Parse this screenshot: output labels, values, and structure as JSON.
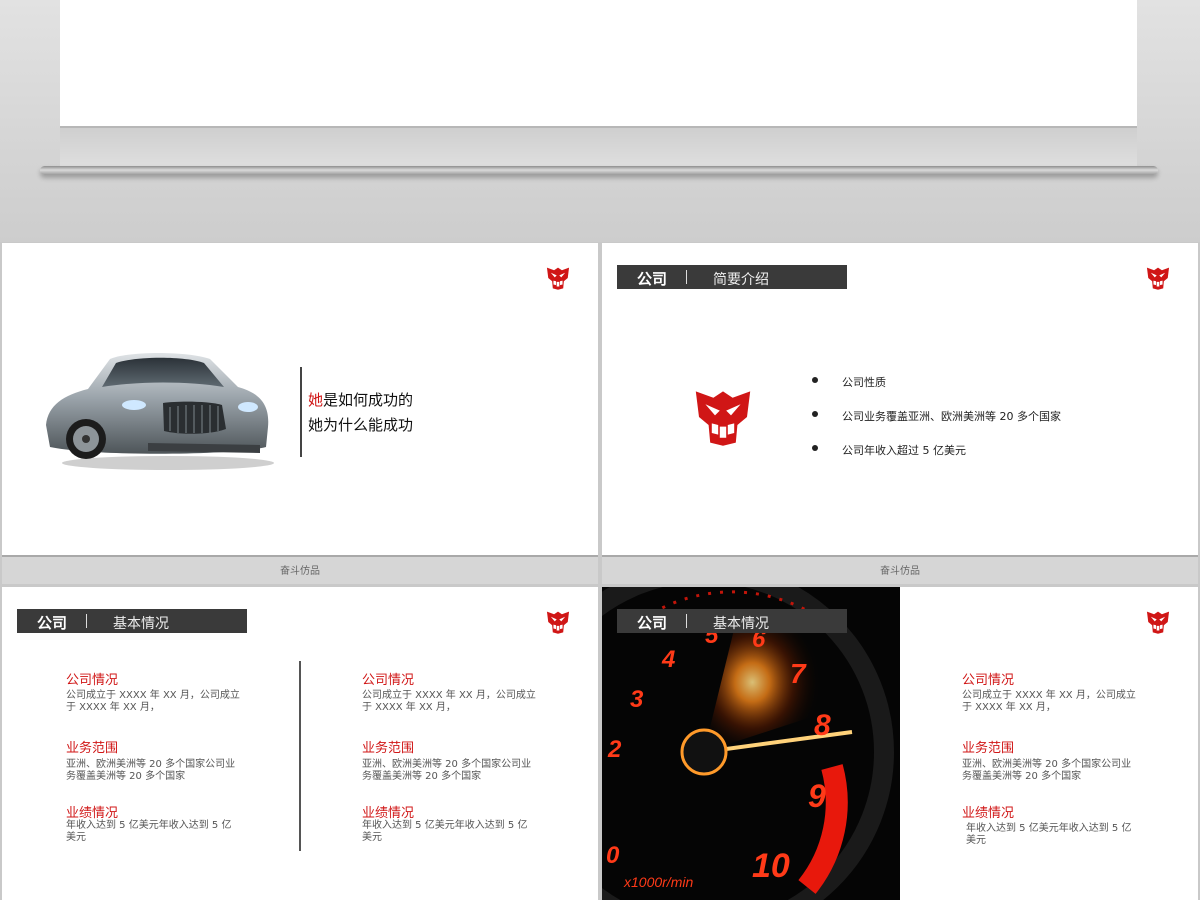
{
  "footer": {
    "label": "奋斗仿品"
  },
  "slide1": {
    "line1_highlight": "她",
    "line1_rest": "是如何成功的",
    "line2": "她为什么能成功"
  },
  "slide2": {
    "title": "公司",
    "subtitle": "简要介绍",
    "bullets": [
      "公司性质",
      "公司业务覆盖亚洲、欧洲美洲等 20 多个国家",
      "公司年收入超过 5 亿美元"
    ]
  },
  "slide3": {
    "title": "公司",
    "subtitle": "基本情况",
    "left": [
      {
        "head": "公司情况",
        "body": "公司成立于 XXXX 年 XX 月，公司成立于 XXXX 年 XX 月，"
      },
      {
        "head": "业务范围",
        "body": "亚洲、欧洲美洲等 20 多个国家公司业务覆盖美洲等 20 多个国家"
      },
      {
        "head": "业绩情况",
        "body": "年收入达到 5 亿美元年收入达到 5 亿美元"
      }
    ],
    "right": [
      {
        "head": "公司情况",
        "body": "公司成立于 XXXX 年 XX 月，公司成立于 XXXX 年 XX 月，"
      },
      {
        "head": "业务范围",
        "body": "亚洲、欧洲美洲等 20 多个国家公司业务覆盖美洲等 20 多个国家"
      },
      {
        "head": "业绩情况",
        "body": "年收入达到 5 亿美元年收入达到 5 亿美元"
      }
    ]
  },
  "slide4": {
    "title": "公司",
    "subtitle": "基本情况",
    "gauge_numbers": [
      "2",
      "3",
      "4",
      "5",
      "6",
      "7",
      "8",
      "9",
      "10",
      "0"
    ],
    "gauge_unit": "x1000r/min",
    "blocks": [
      {
        "head": "公司情况",
        "body": "公司成立于 XXXX 年 XX 月，公司成立于 XXXX 年 XX 月，"
      },
      {
        "head": "业务范围",
        "body": "亚洲、欧洲美洲等 20 多个国家公司业务覆盖美洲等 20 多个国家"
      },
      {
        "head": "业绩情况",
        "body": "年收入达到 5 亿美元年收入达到 5 亿美元"
      }
    ]
  },
  "colors": {
    "accent": "#d01616",
    "title_bar": "#3a3a3a"
  }
}
